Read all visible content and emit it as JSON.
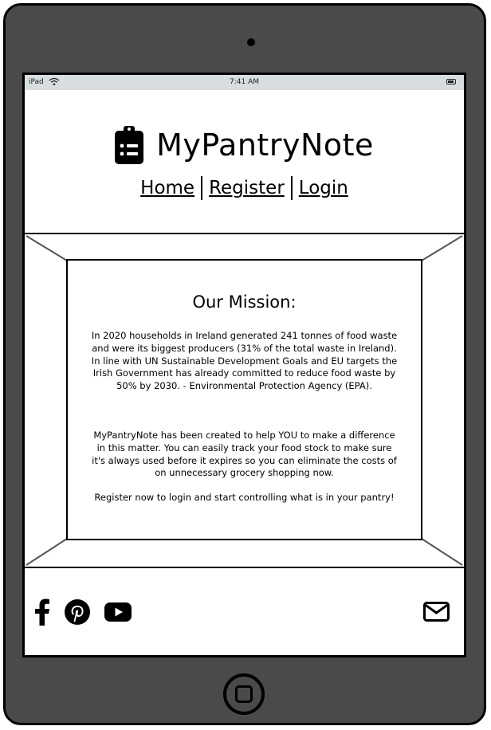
{
  "status_bar": {
    "carrier": "iPad",
    "time": "7:41 AM"
  },
  "header": {
    "title": "MyPantryNote",
    "nav": [
      {
        "label": "Home"
      },
      {
        "label": "Register"
      },
      {
        "label": "Login"
      }
    ]
  },
  "mission": {
    "heading": "Our Mission:",
    "paragraph1": "In 2020 households in Ireland generated 241 tonnes of food waste and were its biggest producers (31% of the total waste in Ireland). In line with UN Sustainable Development Goals and EU targets the Irish Government has already committed to reduce food waste by 50% by 2030. - Environmental Protection Agency (EPA).",
    "paragraph2": "MyPantryNote has been created to help YOU to make a difference in this matter. You can easily track your food stock to make sure it's always used before it expires so you can eliminate the costs of on unnecessary grocery shopping now.",
    "paragraph3": "Register now to login and start controlling what is in your pantry!"
  },
  "footer": {
    "social_icons": [
      "facebook-icon",
      "pinterest-icon",
      "youtube-icon"
    ],
    "contact_icon": "mail-icon"
  }
}
